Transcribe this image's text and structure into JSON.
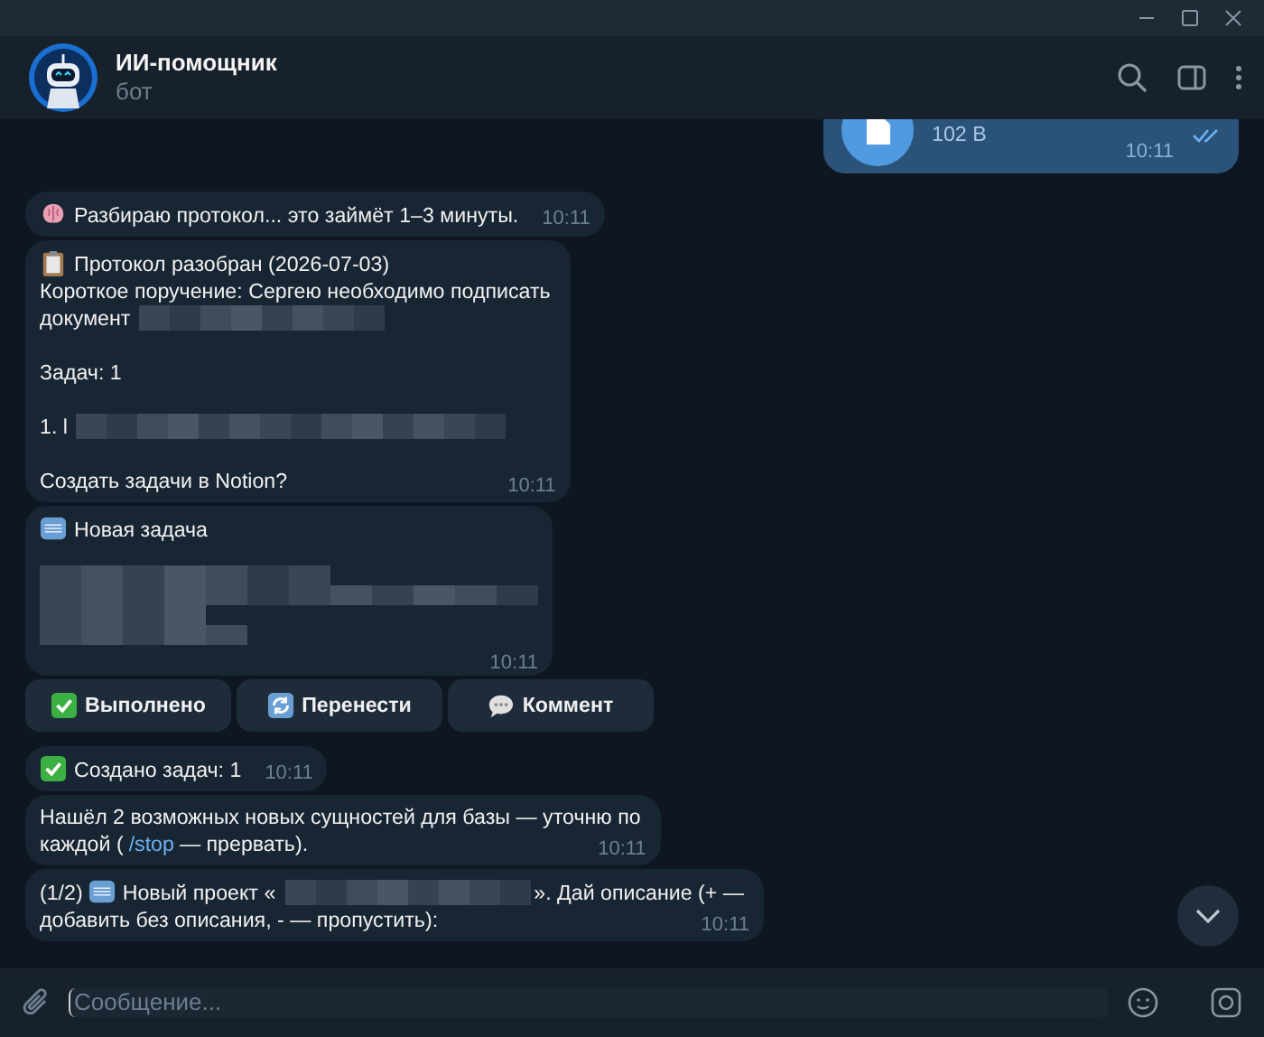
{
  "header": {
    "title": "ИИ-помощник",
    "subtitle": "бот"
  },
  "messages": [
    {
      "kind": "file",
      "size": "102 B",
      "time": "10:11",
      "read": true
    },
    {
      "kind": "text",
      "time": "10:11",
      "parts": [
        {
          "kind": "brain"
        },
        {
          "text": "Разбираю протокол... это займёт 1–3 минуты."
        }
      ]
    },
    {
      "kind": "text",
      "time": "10:11",
      "parts": [
        {
          "kind": "clipboard"
        },
        {
          "text": "Протокол разобран (2026-07-03)"
        },
        {
          "kind": "break"
        },
        {
          "text": "Короткое поручение: Сергею необходимо подписать"
        },
        {
          "kind": "break"
        },
        {
          "text": "документ"
        },
        {
          "kind": "redacted-short"
        },
        {
          "kind": "break"
        },
        {
          "kind": "break"
        },
        {
          "text": "Задач: 1"
        },
        {
          "kind": "break"
        },
        {
          "kind": "break"
        },
        {
          "text": "1. l"
        },
        {
          "kind": "redacted-long"
        },
        {
          "kind": "break"
        },
        {
          "kind": "break"
        },
        {
          "text": "Создать задачи в Notion?"
        }
      ]
    },
    {
      "kind": "text",
      "time": "10:11",
      "parts": [
        {
          "kind": "new"
        },
        {
          "text": "Новая задача"
        },
        {
          "kind": "break"
        },
        {
          "kind": "redacted-block"
        }
      ],
      "buttons": [
        {
          "kind": "check",
          "label": "Выполнено"
        },
        {
          "kind": "refresh",
          "label": "Перенести"
        },
        {
          "kind": "speech",
          "label": "Коммент"
        }
      ]
    },
    {
      "kind": "text",
      "time": "10:11",
      "parts": [
        {
          "kind": "check"
        },
        {
          "text": "Создано задач: 1"
        }
      ]
    },
    {
      "kind": "text",
      "time": "10:11",
      "parts": [
        {
          "text": "Нашёл 2 возможных новых сущностей для базы — уточню по"
        },
        {
          "kind": "break"
        },
        {
          "text": "каждой ("
        },
        {
          "link": "/stop"
        },
        {
          "text": "— прервать)."
        }
      ]
    },
    {
      "kind": "text",
      "time": "10:11",
      "parts": [
        {
          "text": "(1/2)"
        },
        {
          "kind": "new"
        },
        {
          "text": "Новый проект «"
        },
        {
          "kind": "redacted-short"
        },
        {
          "text": "». Дай описание (+ —"
        },
        {
          "kind": "break"
        },
        {
          "text": "добавить без описания, - — пропустить):"
        }
      ]
    }
  ],
  "composer": {
    "placeholder": "Сообщение..."
  }
}
